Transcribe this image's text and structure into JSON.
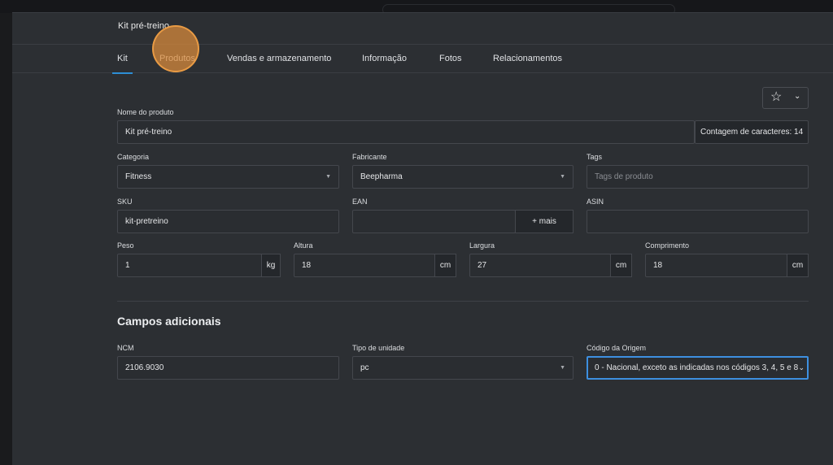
{
  "modal": {
    "title": "Kit pré-treino"
  },
  "tabs": [
    {
      "label": "Kit",
      "active": true
    },
    {
      "label": "Produtos",
      "active": false
    },
    {
      "label": "Vendas e armazenamento",
      "active": false
    },
    {
      "label": "Informação",
      "active": false
    },
    {
      "label": "Fotos",
      "active": false
    },
    {
      "label": "Relacionamentos",
      "active": false
    }
  ],
  "toolbar": {
    "favorite_icon": "star-icon",
    "dropdown_icon": "chevron-down-icon"
  },
  "form": {
    "nome": {
      "label": "Nome do produto",
      "value": "Kit pré-treino",
      "counter": "Contagem de caracteres: 14"
    },
    "categoria": {
      "label": "Categoria",
      "value": "Fitness"
    },
    "fabricante": {
      "label": "Fabricante",
      "value": "Beepharma"
    },
    "tags": {
      "label": "Tags",
      "placeholder": "Tags de produto"
    },
    "sku": {
      "label": "SKU",
      "value": "kit-pretreino"
    },
    "ean": {
      "label": "EAN",
      "value": "",
      "button": "+ mais"
    },
    "asin": {
      "label": "ASIN",
      "value": ""
    },
    "peso": {
      "label": "Peso",
      "value": "1",
      "unit": "kg"
    },
    "altura": {
      "label": "Altura",
      "value": "18",
      "unit": "cm"
    },
    "largura": {
      "label": "Largura",
      "value": "27",
      "unit": "cm"
    },
    "comprimento": {
      "label": "Comprimento",
      "value": "18",
      "unit": "cm"
    }
  },
  "additional": {
    "title": "Campos adicionais",
    "ncm": {
      "label": "NCM",
      "value": "2106.9030"
    },
    "tipo_unidade": {
      "label": "Tipo de unidade",
      "value": "pc"
    },
    "codigo_origem": {
      "label": "Código da Origem",
      "value": "0 - Nacional, exceto as indicadas nos códigos 3, 4, 5 e 8"
    }
  },
  "colors": {
    "background": "#2c2f33",
    "accent": "#2d8fd5",
    "focus": "#3d8fe0",
    "cursor_highlight": "#dc8c3c"
  }
}
